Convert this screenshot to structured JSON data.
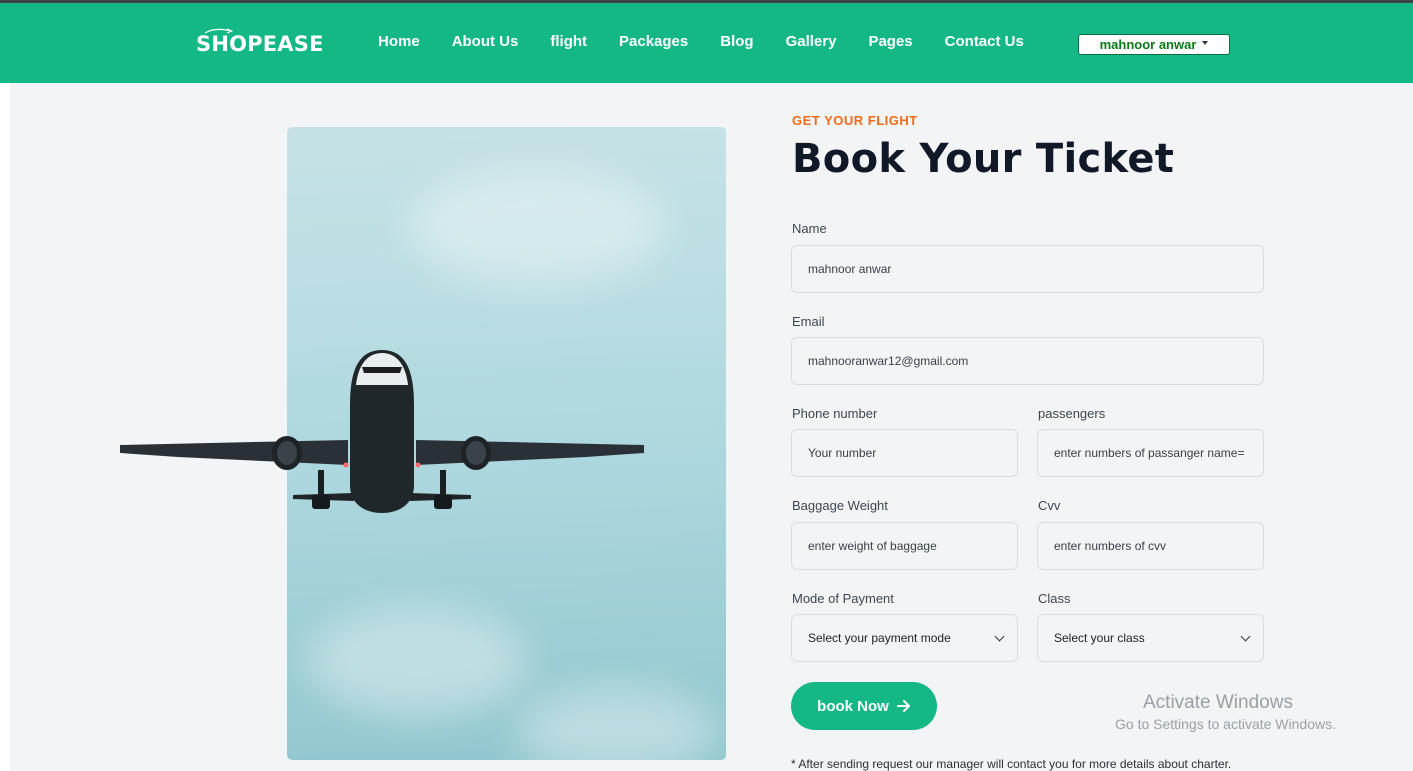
{
  "brand": {
    "name": "SHOPEASE"
  },
  "nav": {
    "links": [
      "Home",
      "About Us",
      "flight",
      "Packages",
      "Blog",
      "Gallery",
      "Pages",
      "Contact Us"
    ],
    "user_name": "mahnoor anwar"
  },
  "hero": {
    "eyebrow": "GET YOUR FLIGHT",
    "title": "Book Your Ticket"
  },
  "form": {
    "name": {
      "label": "Name",
      "value": "mahnoor anwar"
    },
    "email": {
      "label": "Email",
      "value": "mahnooranwar12@gmail.com"
    },
    "phone": {
      "label": "Phone number",
      "placeholder": "Your number"
    },
    "passengers": {
      "label": "passengers",
      "placeholder": "enter numbers of passanger name="
    },
    "baggage": {
      "label": "Baggage Weight",
      "placeholder": "enter weight  of baggage"
    },
    "cvv": {
      "label": "Cvv",
      "placeholder": "enter numbers of cvv"
    },
    "payment": {
      "label": "Mode of Payment",
      "selected": "Select your payment mode"
    },
    "class": {
      "label": "Class",
      "selected": "Select your class"
    },
    "submit_label": "book Now",
    "note": "* After sending request our manager will contact you for more details about charter."
  },
  "watermark": {
    "line1": "Activate Windows",
    "line2": "Go to Settings to activate Windows."
  },
  "colors": {
    "accent": "#13b886",
    "eyebrow": "#f26a1b",
    "title": "#111827"
  }
}
